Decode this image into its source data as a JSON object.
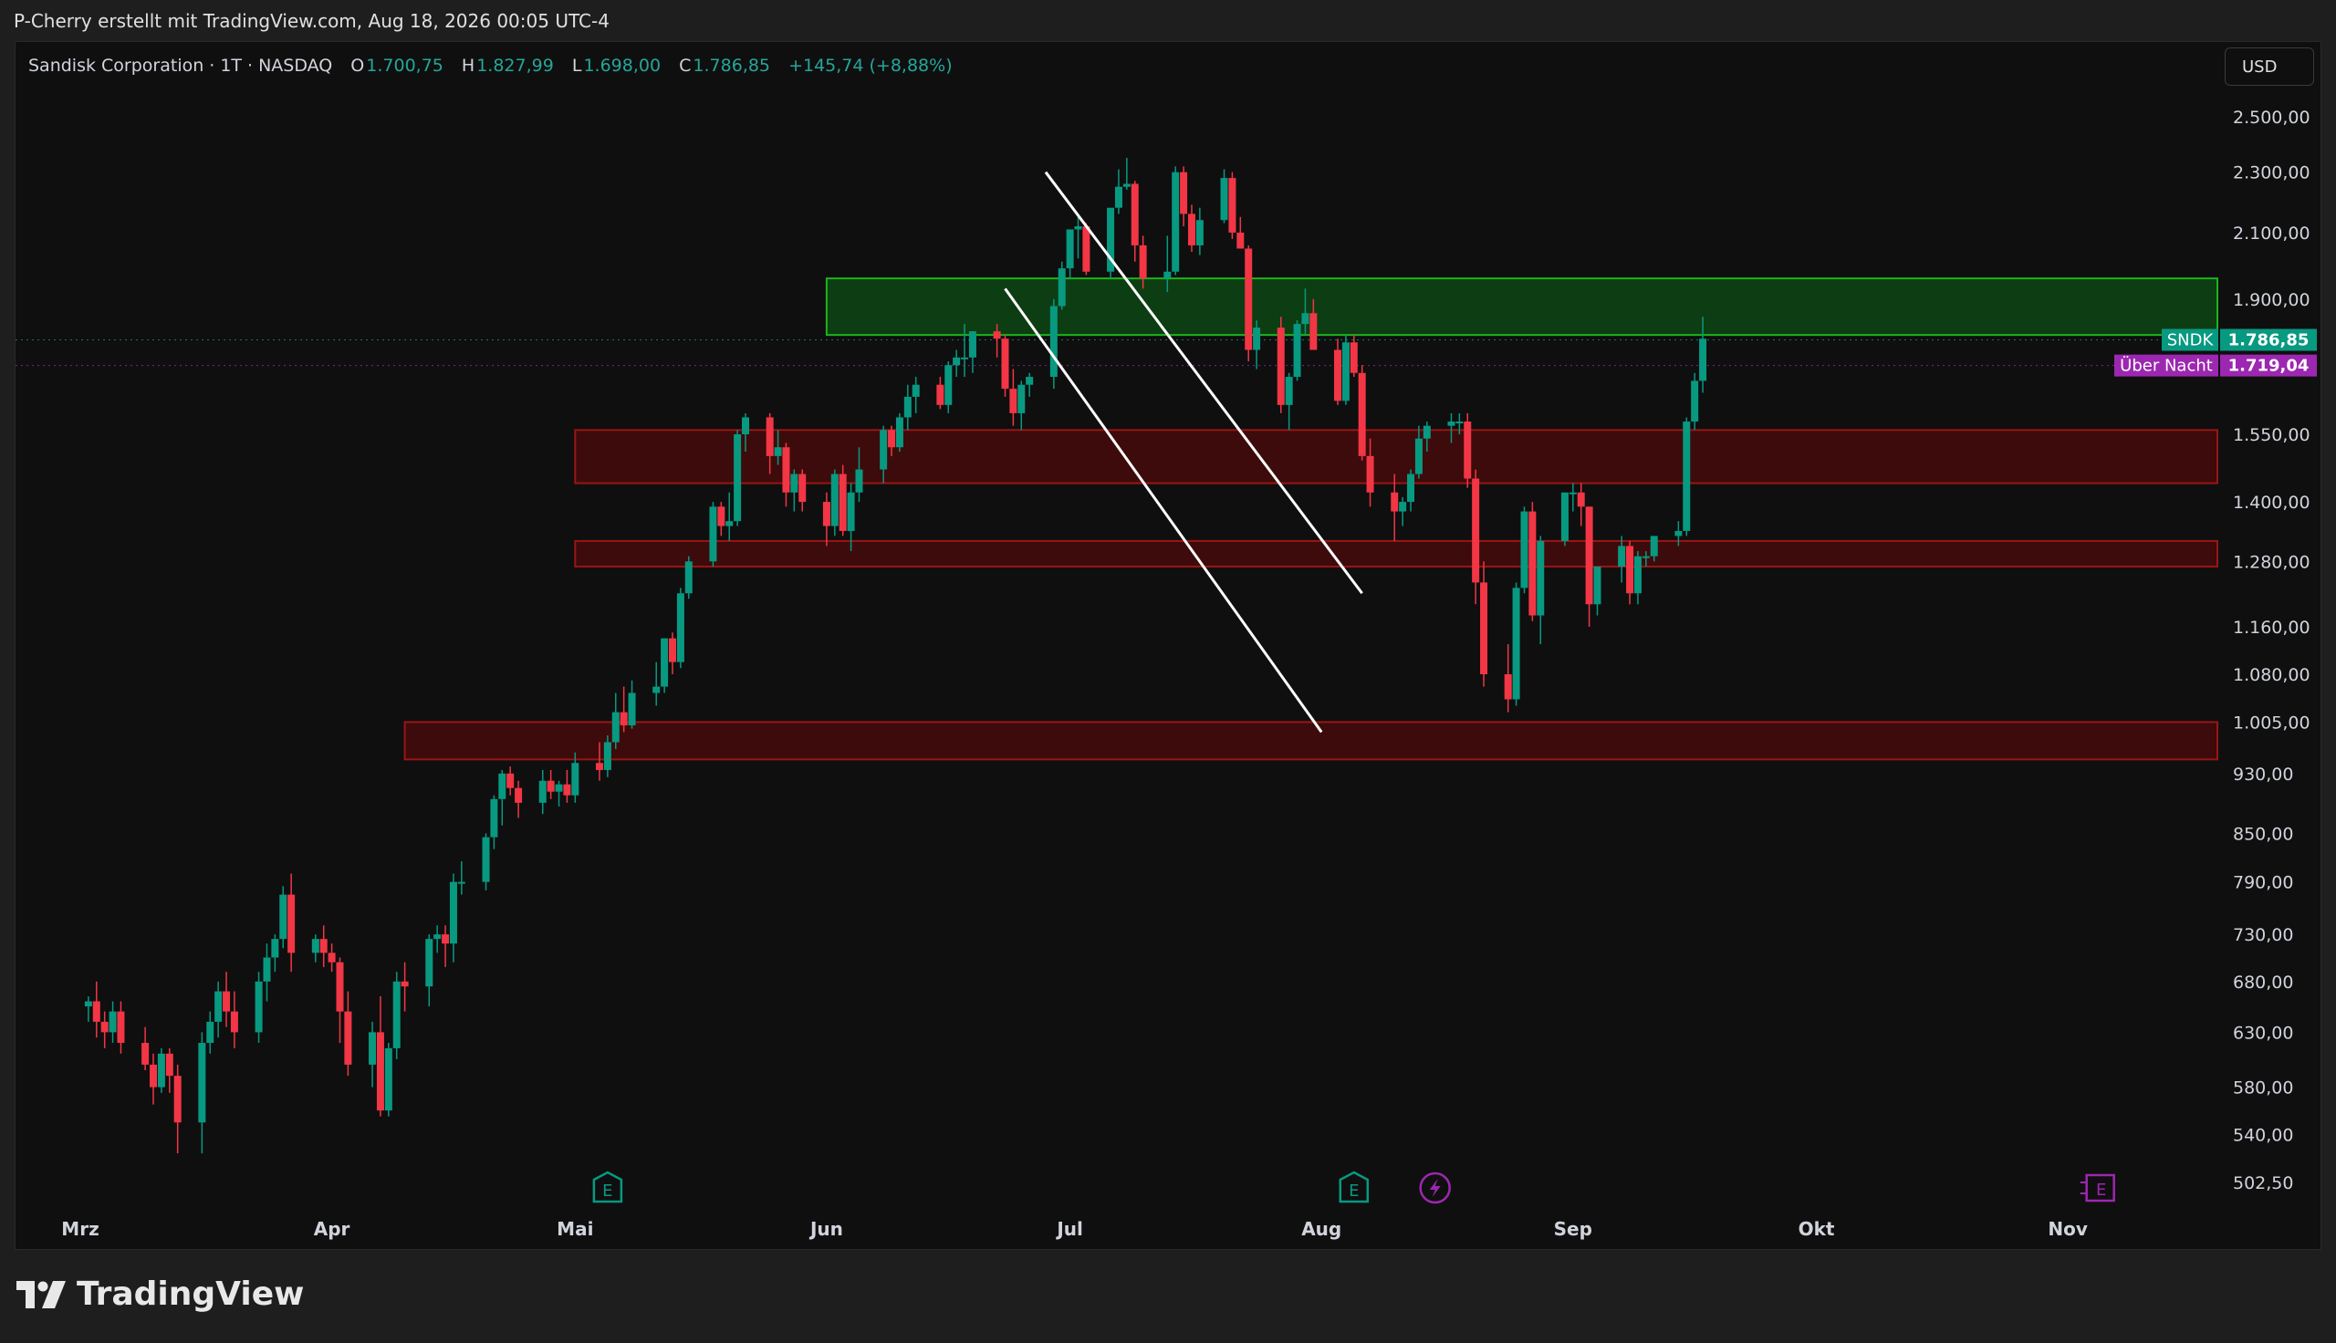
{
  "caption": "P-Cherry erstellt mit TradingView.com, Aug 18, 2026 00:05 UTC-4",
  "header": {
    "symbol_name": "Sandisk Corporation",
    "interval": "1T",
    "exchange": "NASDAQ",
    "open_label": "O",
    "open_value": "1.700,75",
    "high_label": "H",
    "high_value": "1.827,99",
    "low_label": "L",
    "low_value": "1.698,00",
    "close_label": "C",
    "close_value": "1.786,85",
    "change": "+145,74 (+8,88%)",
    "currency_button": "USD"
  },
  "price_tags": {
    "last_symbol": "SNDK",
    "last_value": "1.786,85",
    "overnight_label": "Über Nacht",
    "overnight_value": "1.719,04"
  },
  "events": [
    {
      "type": "earnings",
      "icon": "earnings-icon",
      "letter": "E",
      "date": "2026-05-05",
      "color": "#089981"
    },
    {
      "type": "earnings",
      "icon": "earnings-icon",
      "letter": "E",
      "date": "2026-08-05",
      "color": "#089981"
    },
    {
      "type": "lightning",
      "icon": "lightning-icon",
      "date": "2026-08-15",
      "color": "#9c27b0"
    },
    {
      "type": "earnings-upcoming",
      "icon": "earnings-icon",
      "letter": "E",
      "date": "2026-11-05",
      "color": "#9c27b0"
    }
  ],
  "colors": {
    "up": "#089981",
    "down": "#f23645",
    "overnight": "#9c27b0",
    "zone_green_fill": "#0d3d12",
    "zone_green_border": "#1db41d",
    "zone_red_fill": "#3d0b0b",
    "zone_red_border": "#9a1515",
    "trendline": "#ffffff"
  },
  "footer": {
    "brand": "TradingView"
  },
  "chart_data": {
    "type": "candlestick",
    "scale": "log",
    "y_ticks": [
      "2.500,00",
      "2.300,00",
      "2.100,00",
      "1.900,00",
      "1.550,00",
      "1.400,00",
      "1.280,00",
      "1.160,00",
      "1.080,00",
      "1.005,00",
      "930,00",
      "850,00",
      "790,00",
      "730,00",
      "680,00",
      "630,00",
      "580,00",
      "540,00",
      "502,50"
    ],
    "y_tick_values": [
      2500,
      2300,
      2100,
      1900,
      1550,
      1400,
      1280,
      1160,
      1080,
      1005,
      930,
      850,
      790,
      730,
      680,
      630,
      580,
      540,
      502.5
    ],
    "x_ticks": [
      "Mrz",
      "Apr",
      "Mai",
      "Jun",
      "Jul",
      "Aug",
      "Sep",
      "Okt",
      "Nov"
    ],
    "x_tick_dates": [
      "2026-03-01",
      "2026-04-01",
      "2026-05-01",
      "2026-06-01",
      "2026-07-01",
      "2026-08-01",
      "2026-09-01",
      "2026-10-01",
      "2026-11-01"
    ],
    "candles_ohlc": [
      [
        655,
        665,
        640,
        660
      ],
      [
        660,
        680,
        625,
        640
      ],
      [
        640,
        650,
        615,
        630
      ],
      [
        630,
        660,
        620,
        650
      ],
      [
        650,
        660,
        610,
        620
      ],
      [
        620,
        635,
        595,
        600
      ],
      [
        600,
        610,
        565,
        580
      ],
      [
        580,
        615,
        575,
        610
      ],
      [
        610,
        615,
        575,
        590
      ],
      [
        590,
        600,
        525,
        550
      ],
      [
        550,
        630,
        525,
        620
      ],
      [
        620,
        650,
        610,
        640
      ],
      [
        640,
        680,
        625,
        670
      ],
      [
        670,
        690,
        635,
        650
      ],
      [
        650,
        670,
        615,
        630
      ],
      [
        630,
        690,
        620,
        680
      ],
      [
        680,
        720,
        660,
        705
      ],
      [
        705,
        730,
        690,
        725
      ],
      [
        725,
        785,
        715,
        775
      ],
      [
        775,
        800,
        690,
        710
      ],
      [
        710,
        730,
        700,
        725
      ],
      [
        725,
        740,
        695,
        710
      ],
      [
        710,
        720,
        690,
        700
      ],
      [
        700,
        705,
        620,
        650
      ],
      [
        650,
        670,
        590,
        600
      ],
      [
        600,
        640,
        580,
        630
      ],
      [
        630,
        665,
        555,
        560
      ],
      [
        560,
        620,
        555,
        615
      ],
      [
        615,
        690,
        605,
        680
      ],
      [
        680,
        700,
        650,
        675
      ],
      [
        675,
        730,
        655,
        725
      ],
      [
        725,
        740,
        710,
        730
      ],
      [
        730,
        740,
        695,
        720
      ],
      [
        720,
        800,
        700,
        790
      ],
      [
        790,
        815,
        775,
        790
      ],
      [
        790,
        850,
        780,
        845
      ],
      [
        845,
        900,
        830,
        895
      ],
      [
        895,
        935,
        860,
        930
      ],
      [
        930,
        940,
        900,
        910
      ],
      [
        910,
        920,
        870,
        890
      ],
      [
        890,
        935,
        875,
        920
      ],
      [
        920,
        935,
        895,
        905
      ],
      [
        905,
        920,
        885,
        915
      ],
      [
        915,
        935,
        890,
        900
      ],
      [
        900,
        960,
        890,
        945
      ],
      [
        945,
        975,
        920,
        935
      ],
      [
        935,
        985,
        925,
        975
      ],
      [
        975,
        1050,
        965,
        1020
      ],
      [
        1020,
        1060,
        990,
        1000
      ],
      [
        1000,
        1070,
        995,
        1050
      ],
      [
        1050,
        1100,
        1030,
        1060
      ],
      [
        1060,
        1140,
        1050,
        1140
      ],
      [
        1140,
        1150,
        1080,
        1100
      ],
      [
        1100,
        1230,
        1090,
        1220
      ],
      [
        1220,
        1290,
        1210,
        1280
      ],
      [
        1280,
        1400,
        1270,
        1390
      ],
      [
        1390,
        1400,
        1330,
        1350
      ],
      [
        1350,
        1420,
        1320,
        1360
      ],
      [
        1360,
        1560,
        1350,
        1550
      ],
      [
        1550,
        1600,
        1510,
        1590
      ],
      [
        1590,
        1600,
        1460,
        1500
      ],
      [
        1500,
        1560,
        1480,
        1520
      ],
      [
        1520,
        1530,
        1390,
        1420
      ],
      [
        1420,
        1470,
        1380,
        1460
      ],
      [
        1460,
        1470,
        1380,
        1400
      ],
      [
        1400,
        1420,
        1310,
        1350
      ],
      [
        1350,
        1470,
        1330,
        1460
      ],
      [
        1460,
        1480,
        1330,
        1340
      ],
      [
        1340,
        1440,
        1300,
        1420
      ],
      [
        1420,
        1520,
        1400,
        1470
      ],
      [
        1470,
        1570,
        1440,
        1560
      ],
      [
        1560,
        1570,
        1500,
        1520
      ],
      [
        1520,
        1600,
        1510,
        1590
      ],
      [
        1590,
        1670,
        1560,
        1640
      ],
      [
        1640,
        1690,
        1600,
        1670
      ],
      [
        1670,
        1690,
        1610,
        1620
      ],
      [
        1620,
        1730,
        1600,
        1720
      ],
      [
        1720,
        1760,
        1690,
        1740
      ],
      [
        1740,
        1830,
        1690,
        1740
      ],
      [
        1740,
        1810,
        1700,
        1810
      ],
      [
        1810,
        1830,
        1740,
        1790
      ],
      [
        1790,
        1800,
        1640,
        1660
      ],
      [
        1660,
        1710,
        1570,
        1600
      ],
      [
        1600,
        1680,
        1560,
        1670
      ],
      [
        1670,
        1700,
        1640,
        1690
      ],
      [
        1690,
        1900,
        1660,
        1880
      ],
      [
        1880,
        2010,
        1870,
        1990
      ],
      [
        1990,
        2100,
        1960,
        2110
      ],
      [
        2110,
        2150,
        2020,
        2120
      ],
      [
        2120,
        2130,
        1970,
        1980
      ],
      [
        1980,
        2160,
        1960,
        2180
      ],
      [
        2180,
        2310,
        2160,
        2250
      ],
      [
        2250,
        2350,
        2240,
        2260
      ],
      [
        2260,
        2270,
        2010,
        2060
      ],
      [
        2060,
        2090,
        1930,
        1960
      ],
      [
        1960,
        2090,
        1920,
        1980
      ],
      [
        1980,
        2320,
        1970,
        2300
      ],
      [
        2300,
        2320,
        2120,
        2160
      ],
      [
        2160,
        2190,
        2040,
        2060
      ],
      [
        2060,
        2180,
        2030,
        2140
      ],
      [
        2140,
        2310,
        2130,
        2280
      ],
      [
        2280,
        2300,
        2080,
        2100
      ],
      [
        2100,
        2150,
        2050,
        2050
      ],
      [
        2050,
        2060,
        1730,
        1760
      ],
      [
        1760,
        1840,
        1710,
        1820
      ],
      [
        1820,
        1850,
        1600,
        1620
      ],
      [
        1620,
        1700,
        1560,
        1690
      ],
      [
        1690,
        1840,
        1680,
        1830
      ],
      [
        1830,
        1930,
        1800,
        1860
      ],
      [
        1860,
        1900,
        1760,
        1760
      ],
      [
        1760,
        1790,
        1620,
        1630
      ],
      [
        1630,
        1800,
        1620,
        1780
      ],
      [
        1780,
        1800,
        1690,
        1700
      ],
      [
        1700,
        1720,
        1490,
        1500
      ],
      [
        1500,
        1540,
        1390,
        1420
      ],
      [
        1420,
        1460,
        1320,
        1380
      ],
      [
        1380,
        1410,
        1350,
        1400
      ],
      [
        1400,
        1470,
        1380,
        1460
      ],
      [
        1460,
        1570,
        1450,
        1540
      ],
      [
        1540,
        1580,
        1510,
        1570
      ],
      [
        1570,
        1600,
        1530,
        1580
      ],
      [
        1580,
        1600,
        1550,
        1580
      ],
      [
        1580,
        1600,
        1430,
        1450
      ],
      [
        1450,
        1470,
        1200,
        1240
      ],
      [
        1240,
        1280,
        1060,
        1080
      ],
      [
        1080,
        1130,
        1020,
        1040
      ],
      [
        1040,
        1240,
        1030,
        1230
      ],
      [
        1230,
        1390,
        1220,
        1380
      ],
      [
        1380,
        1400,
        1170,
        1180
      ],
      [
        1180,
        1330,
        1130,
        1320
      ],
      [
        1320,
        1410,
        1310,
        1420
      ],
      [
        1420,
        1440,
        1380,
        1420
      ],
      [
        1420,
        1440,
        1350,
        1390
      ],
      [
        1390,
        1390,
        1160,
        1200
      ],
      [
        1200,
        1270,
        1180,
        1270
      ],
      [
        1270,
        1330,
        1240,
        1310
      ],
      [
        1310,
        1320,
        1200,
        1220
      ],
      [
        1220,
        1300,
        1200,
        1290
      ],
      [
        1290,
        1300,
        1270,
        1290
      ],
      [
        1290,
        1330,
        1280,
        1330
      ],
      [
        1330,
        1360,
        1310,
        1340
      ],
      [
        1340,
        1590,
        1330,
        1580
      ],
      [
        1580,
        1700,
        1560,
        1680
      ],
      [
        1680,
        1850,
        1650,
        1790
      ]
    ],
    "zones": [
      {
        "low": 1800,
        "high": 1960,
        "color": "green",
        "from": "2026-06-01"
      },
      {
        "low": 1440,
        "high": 1560,
        "color": "red",
        "from": "2026-05-01"
      },
      {
        "low": 1270,
        "high": 1320,
        "color": "red",
        "from": "2026-05-01"
      },
      {
        "low": 950,
        "high": 1005,
        "color": "red",
        "from": "2026-04-10"
      }
    ],
    "trendlines": [
      {
        "from": [
          "2026-06-23",
          1930
        ],
        "to": [
          "2026-08-01",
          990
        ]
      },
      {
        "from": [
          "2026-06-28",
          2300
        ],
        "to": [
          "2026-08-06",
          1220
        ]
      }
    ],
    "price_lines": [
      {
        "value": 1786.85,
        "color": "#089981"
      },
      {
        "value": 1719.04,
        "color": "#9c27b0"
      }
    ]
  }
}
